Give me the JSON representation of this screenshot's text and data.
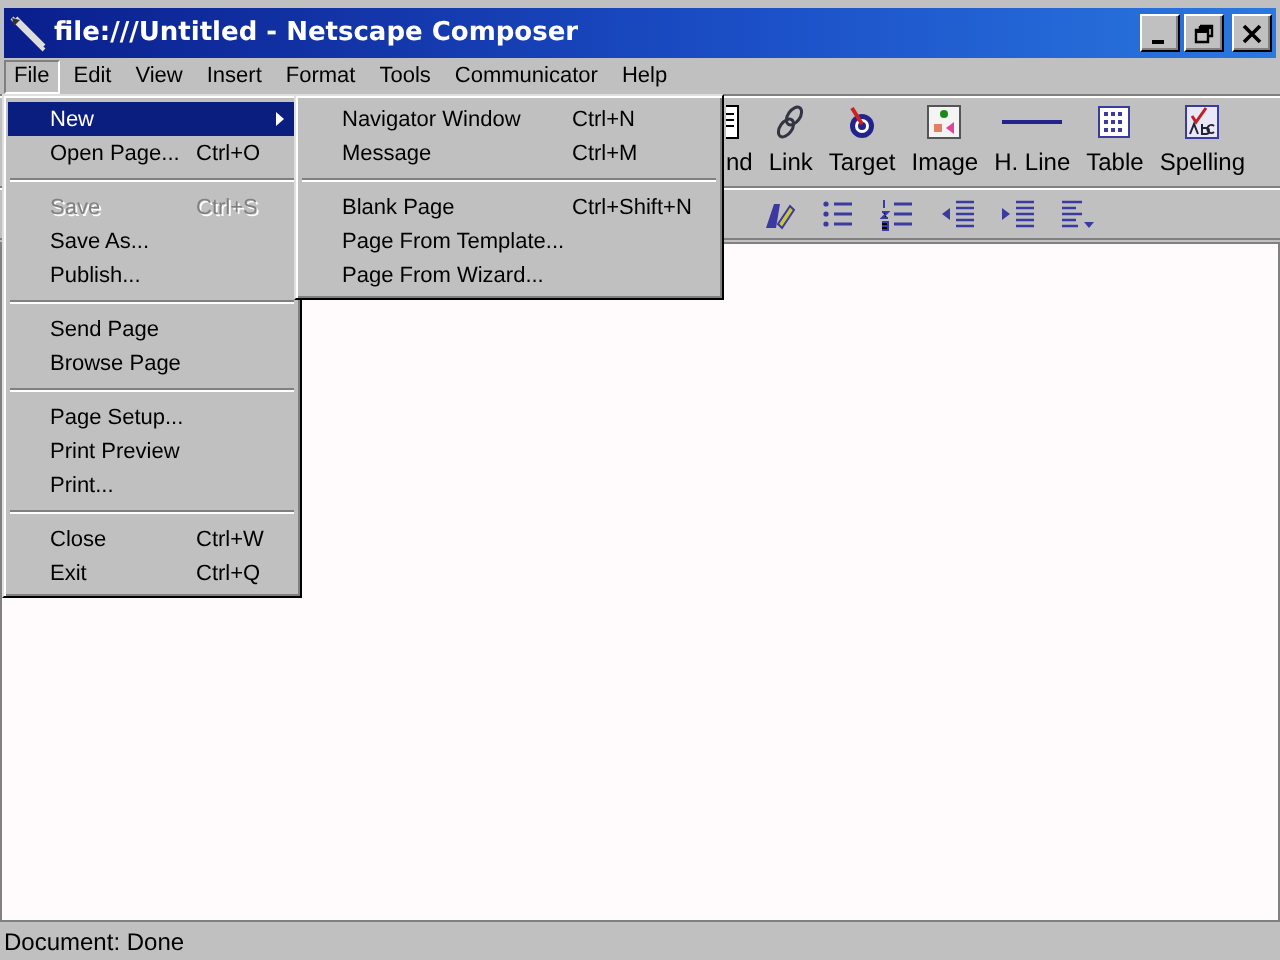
{
  "window": {
    "title": "file:///Untitled - Netscape Composer"
  },
  "menubar": [
    {
      "label": "File",
      "selected": true
    },
    {
      "label": "Edit",
      "selected": false
    },
    {
      "label": "View",
      "selected": false
    },
    {
      "label": "Insert",
      "selected": false
    },
    {
      "label": "Format",
      "selected": false
    },
    {
      "label": "Tools",
      "selected": false
    },
    {
      "label": "Communicator",
      "selected": false
    },
    {
      "label": "Help",
      "selected": false
    }
  ],
  "toolbar": {
    "buttons": [
      {
        "label": "nd"
      },
      {
        "label": "Link"
      },
      {
        "label": "Target"
      },
      {
        "label": "Image"
      },
      {
        "label": "H. Line"
      },
      {
        "label": "Table"
      },
      {
        "label": "Spelling"
      }
    ]
  },
  "file_menu": {
    "items": [
      {
        "kind": "item",
        "label": "New",
        "submenu": true,
        "selected": true,
        "disabled": false
      },
      {
        "kind": "item",
        "label": "Open Page...",
        "shortcut": "Ctrl+O",
        "submenu": false,
        "selected": false,
        "disabled": false
      },
      {
        "kind": "separator"
      },
      {
        "kind": "item",
        "label": "Save",
        "shortcut": "Ctrl+S",
        "submenu": false,
        "selected": false,
        "disabled": true
      },
      {
        "kind": "item",
        "label": "Save As...",
        "submenu": false,
        "selected": false,
        "disabled": false
      },
      {
        "kind": "item",
        "label": "Publish...",
        "submenu": false,
        "selected": false,
        "disabled": false
      },
      {
        "kind": "separator"
      },
      {
        "kind": "item",
        "label": "Send Page",
        "submenu": false,
        "selected": false,
        "disabled": false
      },
      {
        "kind": "item",
        "label": "Browse Page",
        "submenu": false,
        "selected": false,
        "disabled": false
      },
      {
        "kind": "separator"
      },
      {
        "kind": "item",
        "label": "Page Setup...",
        "submenu": false,
        "selected": false,
        "disabled": false
      },
      {
        "kind": "item",
        "label": "Print Preview",
        "submenu": false,
        "selected": false,
        "disabled": false
      },
      {
        "kind": "item",
        "label": "Print...",
        "submenu": false,
        "selected": false,
        "disabled": false
      },
      {
        "kind": "separator"
      },
      {
        "kind": "item",
        "label": "Close",
        "shortcut": "Ctrl+W",
        "submenu": false,
        "selected": false,
        "disabled": false
      },
      {
        "kind": "item",
        "label": "Exit",
        "shortcut": "Ctrl+Q",
        "submenu": false,
        "selected": false,
        "disabled": false
      }
    ]
  },
  "new_submenu": {
    "items": [
      {
        "kind": "item",
        "label": "Navigator Window",
        "shortcut": "Ctrl+N",
        "selected": false,
        "disabled": false
      },
      {
        "kind": "item",
        "label": "Message",
        "shortcut": "Ctrl+M",
        "selected": false,
        "disabled": false
      },
      {
        "kind": "separator"
      },
      {
        "kind": "item",
        "label": "Blank Page",
        "shortcut": "Ctrl+Shift+N",
        "selected": false,
        "disabled": false
      },
      {
        "kind": "item",
        "label": "Page From Template...",
        "selected": false,
        "disabled": false
      },
      {
        "kind": "item",
        "label": "Page From Wizard...",
        "selected": false,
        "disabled": false
      }
    ]
  },
  "status_bar": {
    "text": "Document: Done"
  }
}
